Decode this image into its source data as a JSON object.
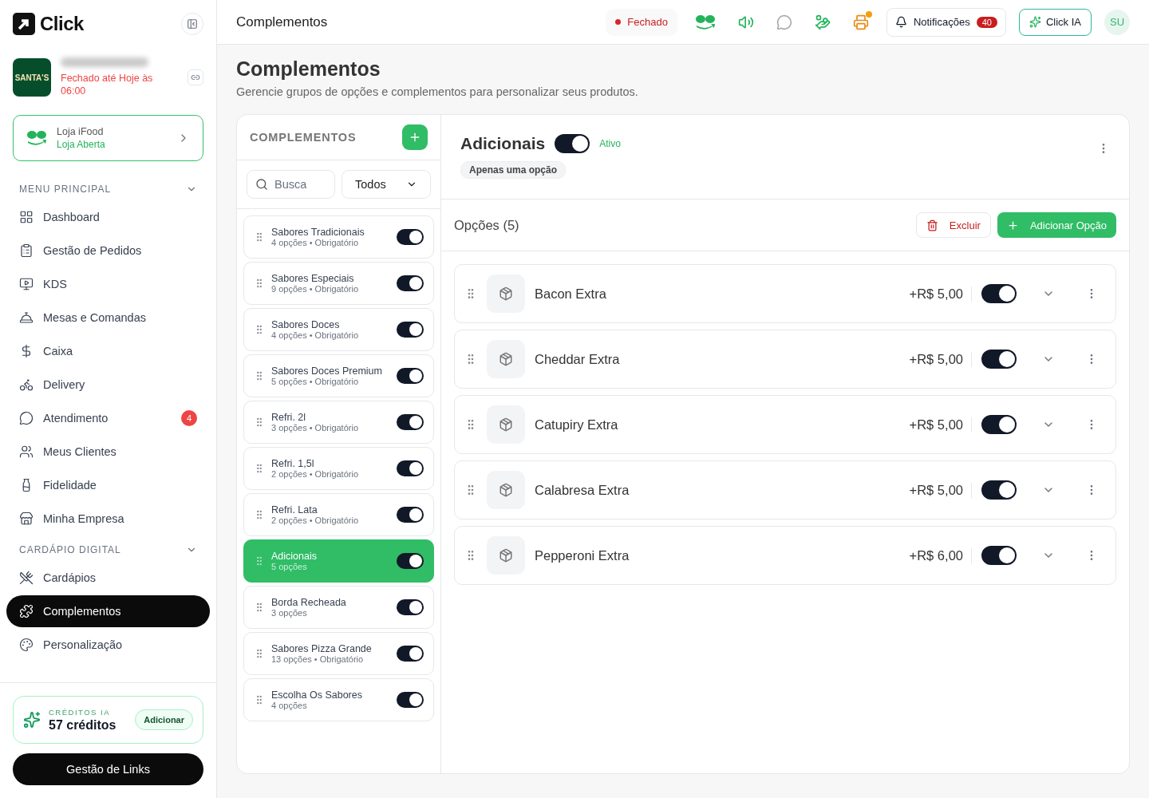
{
  "brand": {
    "name": "Click"
  },
  "store": {
    "logo_text": "SANTA'S",
    "status": "Fechado até Hoje às 06:00"
  },
  "ifood": {
    "title": "Loja iFood",
    "status": "Loja Aberta"
  },
  "nav_sections": [
    {
      "title": "MENU PRINCIPAL",
      "expanded": true,
      "items": [
        {
          "label": "Dashboard",
          "selected": false
        },
        {
          "label": "Gestão de Pedidos",
          "selected": false
        },
        {
          "label": "KDS",
          "selected": false
        },
        {
          "label": "Mesas e Comandas",
          "selected": false
        },
        {
          "label": "Caixa",
          "selected": false
        },
        {
          "label": "Delivery",
          "selected": false
        },
        {
          "label": "Atendimento",
          "selected": false,
          "badge": "4"
        },
        {
          "label": "Meus Clientes",
          "selected": false
        },
        {
          "label": "Fidelidade",
          "selected": false
        },
        {
          "label": "Minha Empresa",
          "selected": false
        }
      ]
    },
    {
      "title": "CARDÁPIO DIGITAL",
      "expanded": true,
      "items": [
        {
          "label": "Cardápios",
          "selected": false
        },
        {
          "label": "Complementos",
          "selected": true
        },
        {
          "label": "Personalização",
          "selected": false
        }
      ]
    }
  ],
  "credits": {
    "label": "CRÉDITOS IA",
    "value": "57 créditos",
    "button": "Adicionar"
  },
  "links_button": "Gestão de Links",
  "header": {
    "title": "Complementos",
    "status": "Fechado",
    "notifications": "Notificações",
    "notifications_count": "40",
    "ai_button": "Click IA",
    "avatar": "SU"
  },
  "page": {
    "title": "Complementos",
    "subtitle": "Gerencie grupos de opções e complementos para personalizar seus produtos."
  },
  "groups_panel": {
    "title": "COMPLEMENTOS",
    "search_placeholder": "Busca",
    "filter": "Todos"
  },
  "groups": [
    {
      "name": "Sabores Tradicionais",
      "meta": "4 opções • Obrigatório",
      "on": true,
      "selected": false
    },
    {
      "name": "Sabores Especiais",
      "meta": "9 opções • Obrigatório",
      "on": true,
      "selected": false
    },
    {
      "name": "Sabores Doces",
      "meta": "4 opções • Obrigatório",
      "on": true,
      "selected": false
    },
    {
      "name": "Sabores Doces Premium",
      "meta": "5 opções • Obrigatório",
      "on": true,
      "selected": false
    },
    {
      "name": "Refri. 2l",
      "meta": "3 opções • Obrigatório",
      "on": true,
      "selected": false
    },
    {
      "name": "Refri. 1,5l",
      "meta": "2 opções • Obrigatório",
      "on": true,
      "selected": false
    },
    {
      "name": "Refri. Lata",
      "meta": "2 opções • Obrigatório",
      "on": true,
      "selected": false
    },
    {
      "name": "Adicionais",
      "meta": "5 opções",
      "on": true,
      "selected": true
    },
    {
      "name": "Borda Recheada",
      "meta": "3 opções",
      "on": true,
      "selected": false
    },
    {
      "name": "Sabores Pizza Grande",
      "meta": "13 opções • Obrigatório",
      "on": true,
      "selected": false
    },
    {
      "name": "Escolha Os Sabores",
      "meta": "4 opções",
      "on": true,
      "selected": false
    }
  ],
  "detail": {
    "title": "Adicionais",
    "on": true,
    "status": "Ativo",
    "tag": "Apenas uma opção",
    "options_title": "Opções (5)",
    "delete_button": "Excluir",
    "add_button": "Adicionar Opção"
  },
  "options": [
    {
      "name": "Bacon Extra",
      "price": "+R$ 5,00",
      "on": true
    },
    {
      "name": "Cheddar Extra",
      "price": "+R$ 5,00",
      "on": true
    },
    {
      "name": "Catupiry Extra",
      "price": "+R$ 5,00",
      "on": true
    },
    {
      "name": "Calabresa Extra",
      "price": "+R$ 5,00",
      "on": true
    },
    {
      "name": "Pepperoni Extra",
      "price": "+R$ 6,00",
      "on": true
    }
  ]
}
